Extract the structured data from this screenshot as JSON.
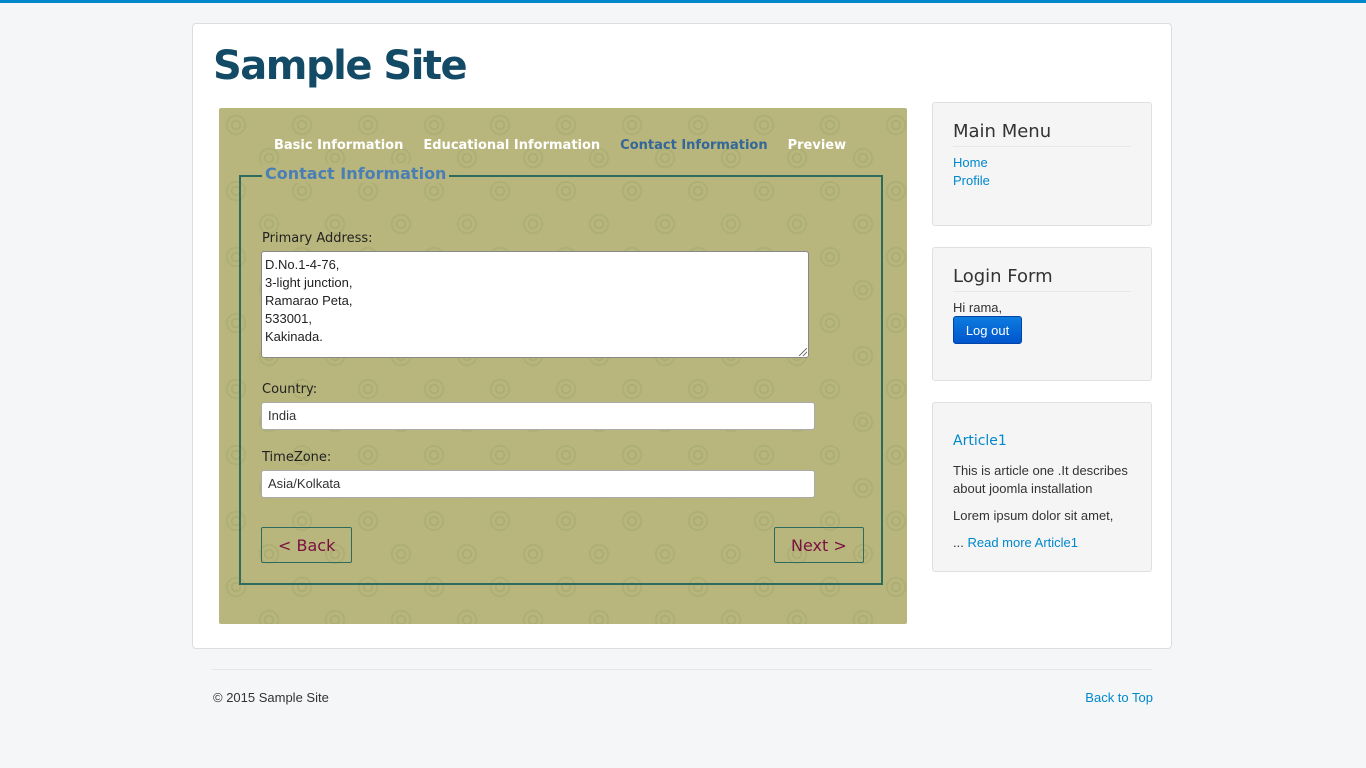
{
  "site": {
    "title": "Sample Site"
  },
  "wizard": {
    "tabs": [
      {
        "label": "Basic Information",
        "active": false
      },
      {
        "label": "Educational Information",
        "active": false
      },
      {
        "label": "Contact Information",
        "active": true
      },
      {
        "label": "Preview",
        "active": false
      }
    ],
    "legend": "Contact Information",
    "primary_address": {
      "label": "Primary Address:",
      "lines": [
        "D.No.1-4-76,",
        "3-light junction,",
        "Ramarao Peta,",
        "533001,",
        "Kakinada."
      ]
    },
    "country": {
      "label": "Country:",
      "value": "India"
    },
    "timezone": {
      "label": "TimeZone:",
      "value": "Asia/Kolkata"
    },
    "back_label": "< Back",
    "next_label": "Next >"
  },
  "sidebar": {
    "main_menu": {
      "title": "Main Menu",
      "items": [
        {
          "label": "Home"
        },
        {
          "label": "Profile"
        }
      ]
    },
    "login_form": {
      "title": "Login Form",
      "greeting": "Hi rama,",
      "logout_label": "Log out"
    },
    "article": {
      "title": "Article1",
      "text": "This is article one .It describes about joomla installation",
      "lorem": "Lorem ipsum dolor sit amet,",
      "ellipsis": "...",
      "read_more": "Read more Article1"
    }
  },
  "footer": {
    "copyright": "© 2015 Sample Site",
    "back_to_top": "Back to Top"
  },
  "colors": {
    "accent": "#0088cc",
    "site_title": "#134b66",
    "wizard_bg": "#b8b67c",
    "fieldset_border": "#2d6b5e",
    "active_tab": "#336699",
    "nav_button_text": "#7a1040"
  }
}
